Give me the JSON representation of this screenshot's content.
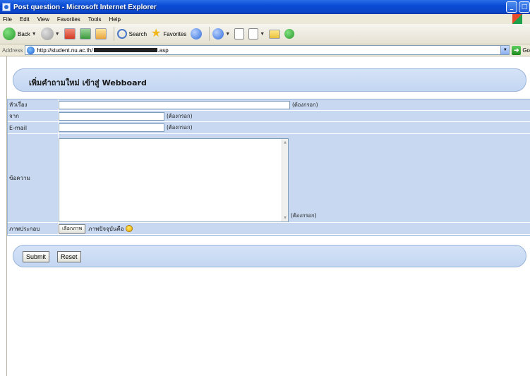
{
  "window": {
    "title": "Post question - Microsoft Internet Explorer",
    "buttons": {
      "minimize": "_",
      "maximize": "□"
    }
  },
  "menu": {
    "items": [
      "File",
      "Edit",
      "View",
      "Favorites",
      "Tools",
      "Help"
    ]
  },
  "toolbar": {
    "back_label": "Back",
    "search_label": "Search",
    "favorites_label": "Favorites"
  },
  "address": {
    "label": "Address",
    "url_prefix": "http://student.nu.ac.th/",
    "url_suffix": ".asp",
    "go_label": "Go"
  },
  "page": {
    "heading": "เพิ่มคำถามใหม่ เข้าสู่ Webboard",
    "required_text": "(ต้องกรอก)",
    "fields": {
      "subject_label": "หัวเรื่อง",
      "from_label": "จาก",
      "email_label": "E-mail",
      "message_label": "ข้อความ",
      "picture_label": "ภาพประกอบ"
    },
    "picture": {
      "choose_button": "เลือกภาพ",
      "note": "ภาพปัจจุบันคือ"
    },
    "buttons": {
      "submit": "Submit",
      "reset": "Reset"
    }
  }
}
